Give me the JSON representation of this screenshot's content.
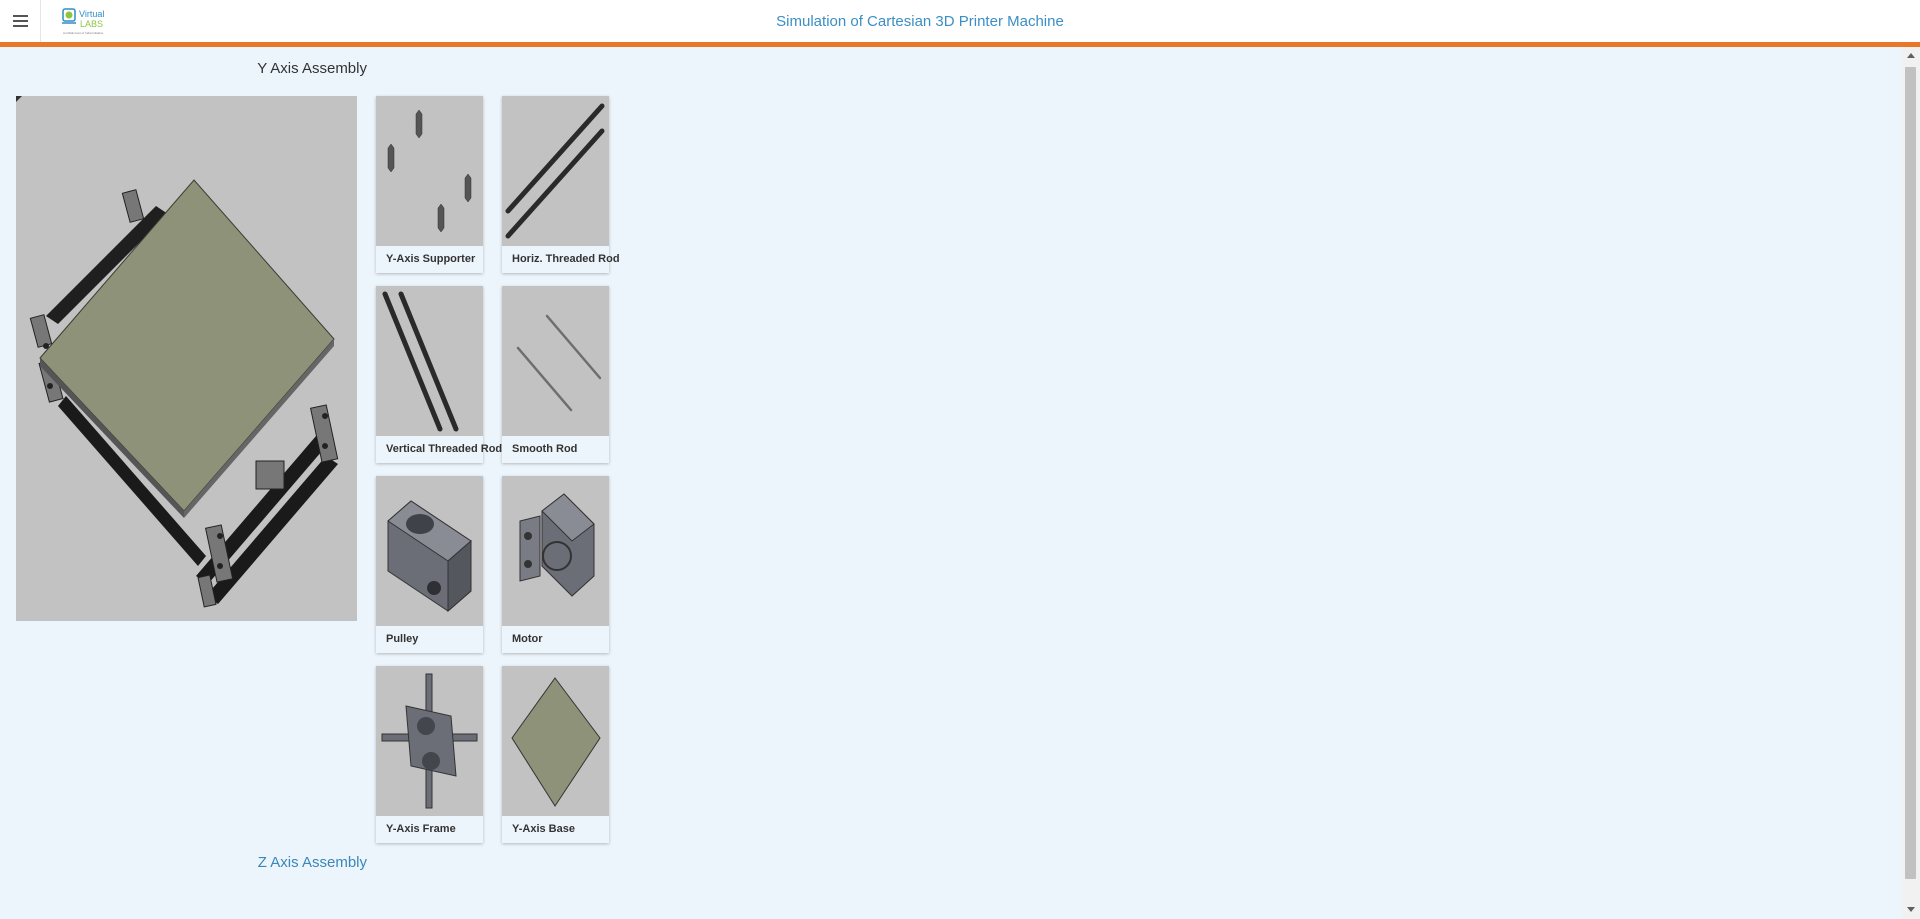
{
  "header": {
    "title": "Simulation of Cartesian 3D Printer Machine",
    "logo_text": "Virtual Labs",
    "logo_tagline": "An MoE Govt of India Initiative"
  },
  "section": {
    "current_title": "Y Axis Assembly",
    "next_title": "Z Axis Assembly"
  },
  "parts": [
    {
      "label": "Y-Axis Supporter",
      "icon": "y-axis-supporter"
    },
    {
      "label": "Horiz. Threaded Rod",
      "icon": "horizontal-threaded-rod"
    },
    {
      "label": "Vertical Threaded Rod",
      "icon": "vertical-threaded-rod"
    },
    {
      "label": "Smooth Rod",
      "icon": "smooth-rod"
    },
    {
      "label": "Pulley",
      "icon": "pulley"
    },
    {
      "label": "Motor",
      "icon": "motor"
    },
    {
      "label": "Y-Axis Frame",
      "icon": "y-axis-frame"
    },
    {
      "label": "Y-Axis Base",
      "icon": "y-axis-base"
    }
  ],
  "colors": {
    "accent": "#e8772a",
    "title": "#3b8fc4",
    "background": "#edf5fc",
    "thumb_bg": "#c2c2c2",
    "bed": "#8d9278"
  }
}
